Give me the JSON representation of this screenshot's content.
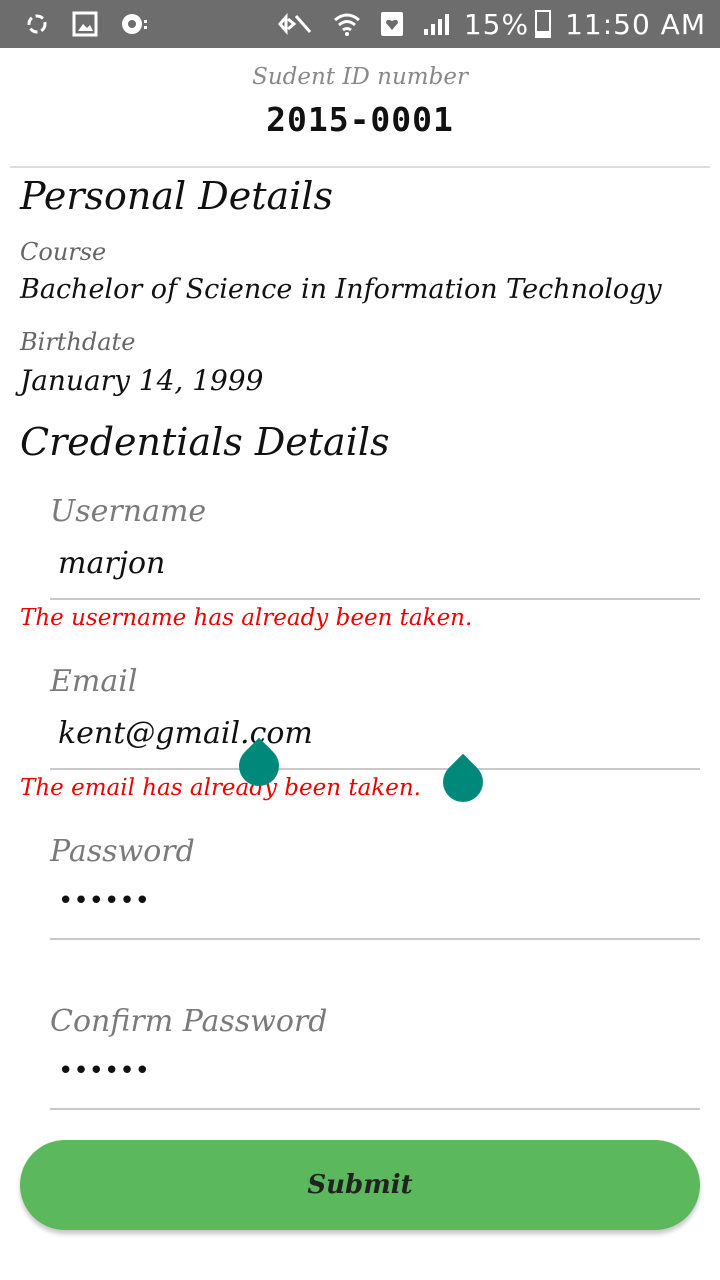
{
  "status_bar": {
    "battery": "15%",
    "time": "11:50 AM",
    "icons": [
      "sync-icon",
      "image-icon",
      "record-icon",
      "mute-icon",
      "wifi-icon",
      "heart-icon",
      "signal-icon",
      "battery-icon"
    ]
  },
  "header": {
    "id_label": "Sudent ID number",
    "id_value": "2015-0001"
  },
  "personal": {
    "title": "Personal Details",
    "course_label": "Course",
    "course_value": "Bachelor of Science in Information Technology",
    "birthdate_label": "Birthdate",
    "birthdate_value": "January 14, 1999"
  },
  "credentials": {
    "title": "Credentials Details",
    "username": {
      "label": "Username",
      "value": "marjon",
      "error": "The username has already been taken."
    },
    "email": {
      "label": "Email",
      "value": "kent@gmail.com",
      "error": "The email has already been taken."
    },
    "password": {
      "label": "Password",
      "value": "••••••"
    },
    "confirm_password": {
      "label": "Confirm Password",
      "value": "••••••"
    }
  },
  "submit_label": "Submit",
  "colors": {
    "status_bar": "#6d6d6d",
    "error": "#ee0000",
    "submit": "#5cb85c",
    "handle": "#00897b"
  }
}
